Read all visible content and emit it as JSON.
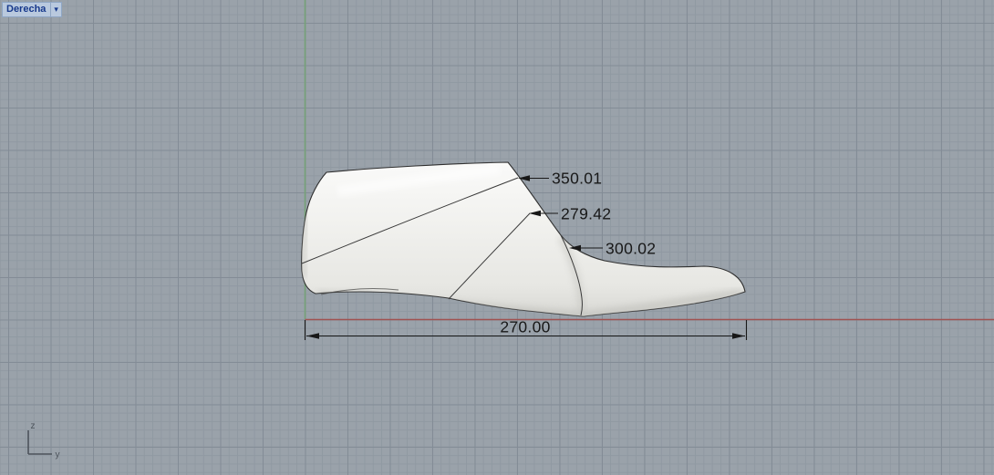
{
  "viewport": {
    "title": "Derecha",
    "dropdown_icon": "▾"
  },
  "axis_indicator": {
    "up_axis_label": "z",
    "right_axis_label": "y"
  },
  "annotations": {
    "heel_girth_label": "350.01",
    "instep_girth_label": "279.42",
    "ball_girth_label": "300.02",
    "length_label": "270.00"
  },
  "colors": {
    "background": "#9aa2aa",
    "grid_minor": "#9099a2",
    "grid_major": "#838c96",
    "axis_vertical_green": "#76a278",
    "axis_horizontal_red": "#a05251",
    "model_outline": "#2f2f2f",
    "dimension_ink": "#181818",
    "model_fill_light": "#fafaf9",
    "model_fill_mid": "#f1f1ee",
    "model_fill_dark": "#d8d8d4",
    "viewport_label_bg": "#b9c9de",
    "viewport_label_text": "#17398c",
    "axis_icon_ink": "#4c535b"
  }
}
